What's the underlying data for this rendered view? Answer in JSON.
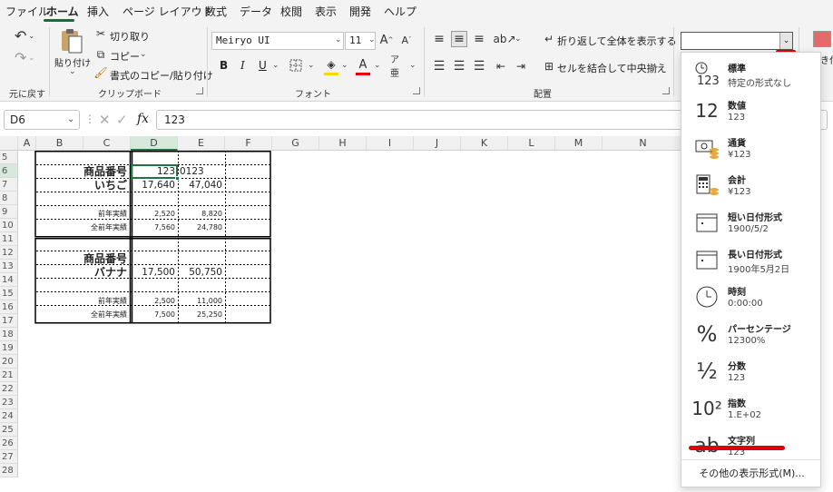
{
  "menu": {
    "tabs": [
      "ファイル",
      "ホーム",
      "挿入",
      "ページ レイアウト",
      "数式",
      "データ",
      "校閲",
      "表示",
      "開発",
      "ヘルプ"
    ],
    "active_tab": "ホーム"
  },
  "ribbon": {
    "undo_group": "元に戻す",
    "clipboard": {
      "label": "クリップボード",
      "paste": "貼り付け",
      "cut": "切り取り",
      "copy": "コピー",
      "format_painter": "書式のコピー/貼り付け"
    },
    "font": {
      "label": "フォント",
      "name": "Meiryo UI",
      "size": "11",
      "bold": "B",
      "italic": "I",
      "underline": "U"
    },
    "alignment": {
      "label": "配置",
      "wrap": "折り返して全体を表示する",
      "merge": "セルを結合して中央揃え"
    },
    "number_format_value": "",
    "right_clip_text": "き付"
  },
  "formula_bar": {
    "name_box": "D6",
    "fx": "fx",
    "formula": "123"
  },
  "columns": [
    "A",
    "B",
    "C",
    "D",
    "E",
    "F",
    "G",
    "H",
    "I",
    "J",
    "K",
    "L",
    "M",
    "N"
  ],
  "rows": [
    "5",
    "6",
    "7",
    "8",
    "9",
    "10",
    "11",
    "12",
    "13",
    "14",
    "15",
    "16",
    "17",
    "18",
    "19",
    "20",
    "21",
    "22",
    "23",
    "24",
    "25",
    "26",
    "27",
    "28"
  ],
  "cells": {
    "b6": "商品番号",
    "d6": "123",
    "e6": "0123",
    "b7": "いちご",
    "d7": "17,640",
    "e7": "47,040",
    "b9": "前年実績",
    "d9": "2,520",
    "e9": "8,820",
    "b10": "全前年実績",
    "d10": "7,560",
    "e10": "24,780",
    "b12": "商品番号",
    "b13": "バナナ",
    "d13": "17,500",
    "e13": "50,750",
    "b15": "前年実績",
    "d15": "2,500",
    "e15": "11,000",
    "b16": "全前年実績",
    "d16": "7,500",
    "e16": "25,250"
  },
  "number_formats": [
    {
      "icon": "123",
      "name": "標準",
      "sub": "特定の形式なし"
    },
    {
      "icon": "12",
      "name": "数値",
      "sub": "123"
    },
    {
      "icon": "currency",
      "name": "通貨",
      "sub": "¥123"
    },
    {
      "icon": "accounting",
      "name": "会計",
      "sub": " ¥123"
    },
    {
      "icon": "calendar",
      "name": "短い日付形式",
      "sub": "1900/5/2"
    },
    {
      "icon": "calendar",
      "name": "長い日付形式",
      "sub": "1900年5月2日"
    },
    {
      "icon": "clock",
      "name": "時刻",
      "sub": "0:00:00"
    },
    {
      "icon": "%",
      "name": "パーセンテージ",
      "sub": "12300%"
    },
    {
      "icon": "½",
      "name": "分数",
      "sub": "123"
    },
    {
      "icon": "10²",
      "name": "指数",
      "sub": "1.E+02"
    },
    {
      "icon": "ab",
      "name": "文字列",
      "sub": "123"
    }
  ],
  "more_formats": "その他の表示形式(M)...",
  "colors": {
    "accent": "#1e6b3a",
    "red": "#e00000",
    "selection": "#217346"
  }
}
